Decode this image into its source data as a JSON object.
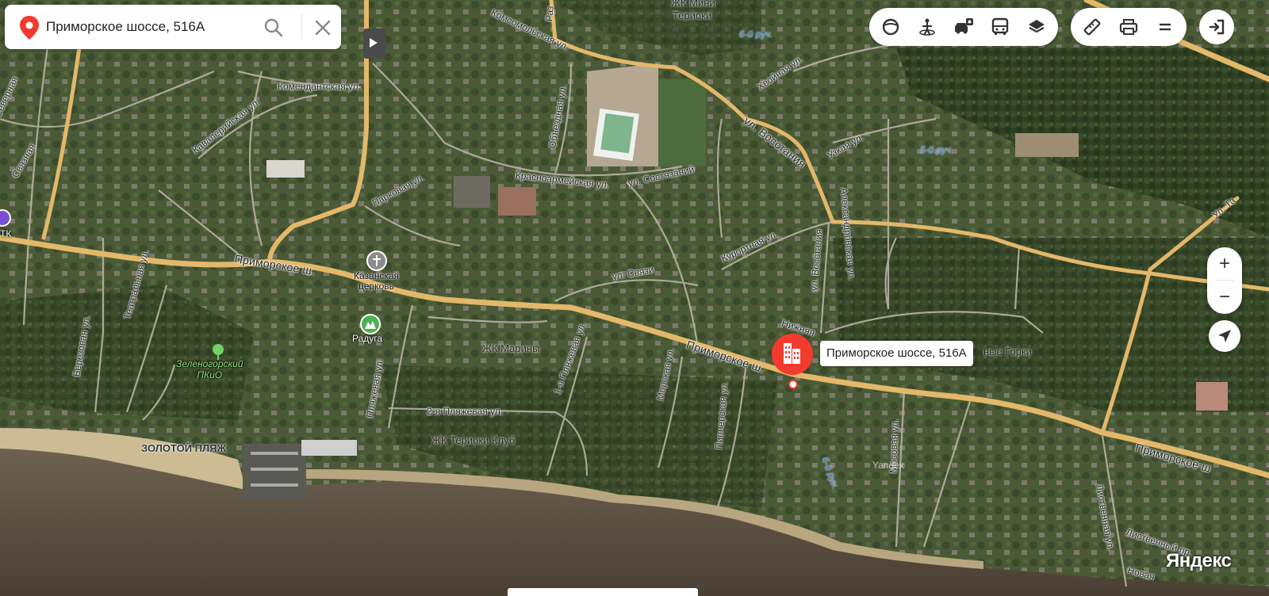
{
  "search": {
    "value": "Приморское шоссе, 516А",
    "placeholder": ""
  },
  "toolbar": {
    "icons": [
      "panorama-icon",
      "pedestrian-icon",
      "traffic-icon",
      "transit-icon",
      "layers-icon",
      "ruler-icon",
      "print-icon",
      "menu-icon",
      "login-icon"
    ]
  },
  "zoom": {
    "plus": "+",
    "minus": "−"
  },
  "marker": {
    "label": "Приморское шоссе, 516А",
    "color": "#f33a2e"
  },
  "labels": {
    "roads": {
      "primorskoe_main": "Приморское ш.",
      "primorskoe_mid": "Приморское ш.",
      "primorskoe_right": "Приморское ш",
      "komsomolskaya": "Комсомольская ул.",
      "kommandantskaya": "Комендантская ул.",
      "kavaleriyskaya": "Кавалерийская ул.",
      "svyaznaya": "Связная",
      "severnaya": "Северная",
      "parkovaya": "Парковая ул.",
      "krasnoarmeyskaya": "Красноармейская ул.",
      "sostyazaniy": "ул. Состязаний",
      "vosstaniya_top": "ул. Восстания",
      "vosstaniya_mid": "ул. Восстания",
      "khvoynaya": "Хвойная ул.",
      "uzkaya": "Узкая ул.",
      "aleksandrovskaya": "Александровская ул.",
      "kurortnaya": "Курортная ул.",
      "svyazi": "ул. Связи",
      "nizhnyaya": "Нижняя",
      "obyezdnaya": "Объездная ул.",
      "teatralnaya": "Театральная ул.",
      "berezovaya": "Березовая ул.",
      "plyazhevaya": "Пляжевая ул.",
      "plyazhevaya2": "2-я Пляжевая ул.",
      "plyazhevaya1": "1-я Пляжевая ул.",
      "morskaya": "Морская ул.",
      "pionerskaya": "Пионерская ул.",
      "mosovaya": "Мосовая ул.",
      "listvennaya": "Лиственная ул.",
      "listvennaya2": "Лиственный пр.",
      "novaya": "Новая",
      "ul_ta": "Ул. Та",
      "raz": "Раз"
    },
    "water": {
      "stream6_top": "6-й руч.",
      "stream5": "5-й руч.",
      "stream6_bottom": "6-й руч."
    },
    "areas": {
      "zhk_mini": "ЖК Мини",
      "terioki": "Териоки",
      "zhk_mariny": "ЖК Марины",
      "zhk_terioki_club": "ЖК Териоки Клуб",
      "gorki": "ные Горки"
    },
    "pois": {
      "church": "Казанская\nцерковь",
      "raduga": "Радуга",
      "park": "Зеленогорский\nПКиО",
      "tk": "ТК"
    },
    "beach": "ЗОЛОТОЙ ПЛЯЖ",
    "watermark": "Yandex",
    "brand": "Яндекс"
  }
}
